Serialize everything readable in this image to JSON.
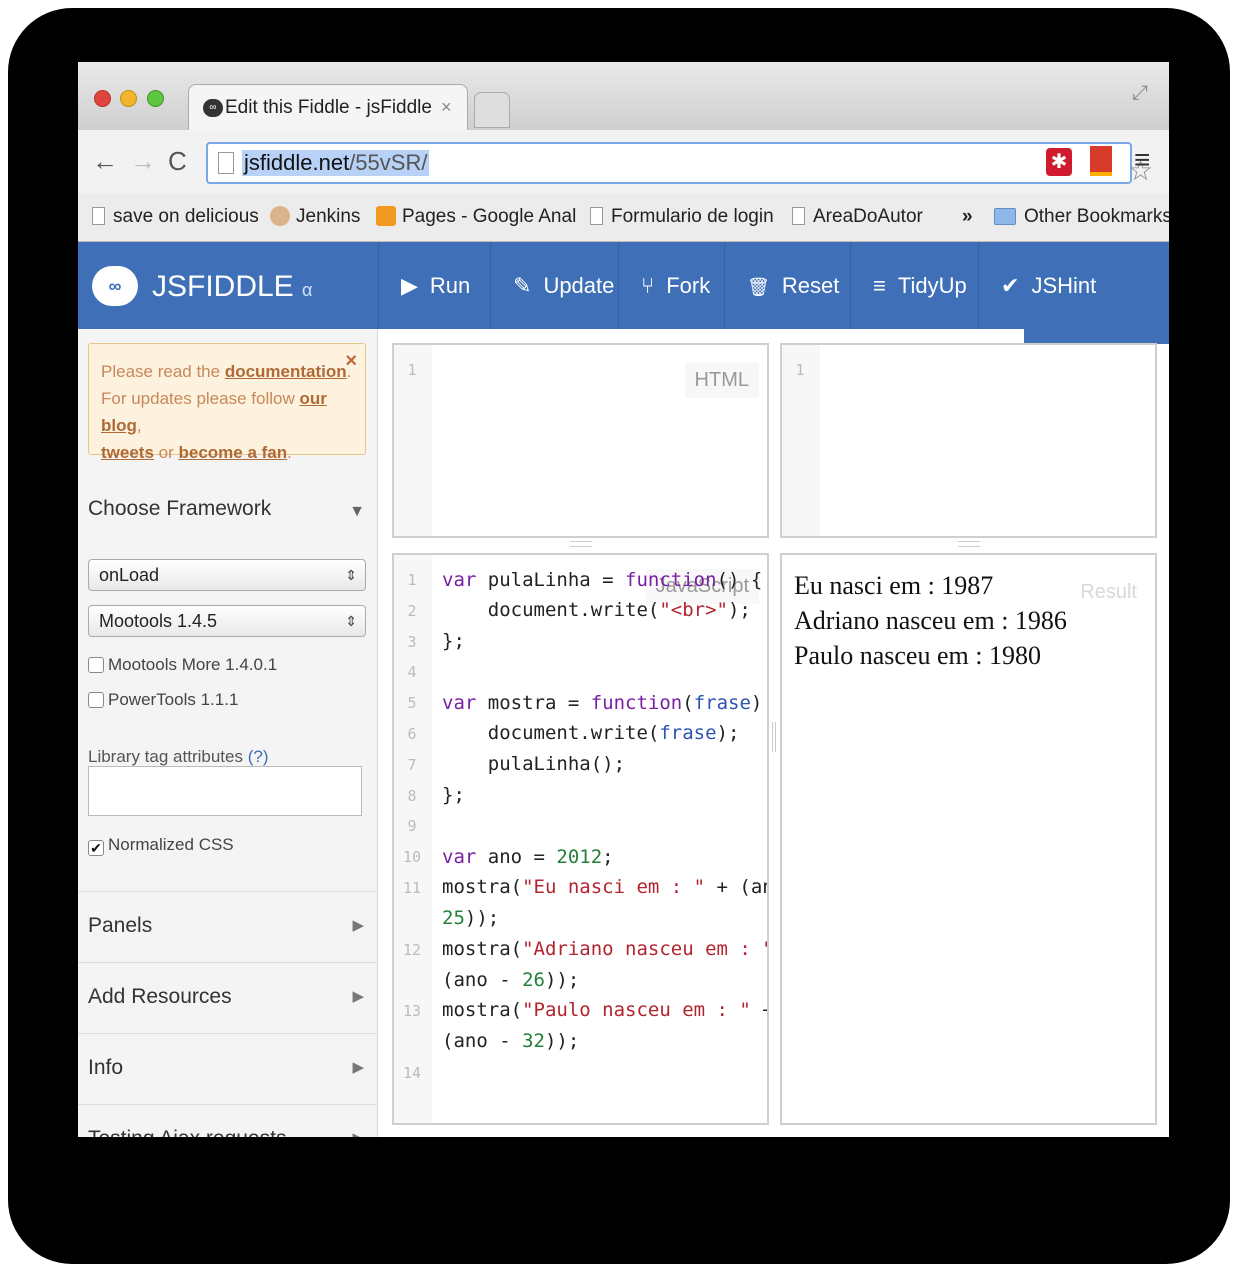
{
  "browser": {
    "tab_title": "Edit this Fiddle - jsFiddle",
    "tab_close": "×",
    "url_host": "jsfiddle.net",
    "url_path": "/55vSR/",
    "bookmarks": [
      {
        "label": "save on delicious"
      },
      {
        "label": "Jenkins"
      },
      {
        "label": "Pages - Google Anal"
      },
      {
        "label": "Formulario de login"
      },
      {
        "label": "AreaDoAutor"
      }
    ],
    "bookmarks_overflow": "»",
    "other_bookmarks": "Other Bookmarks"
  },
  "jsfiddle": {
    "brand": "JSFIDDLE",
    "brand_suffix": "α",
    "buttons": [
      {
        "label": "Run",
        "icon": "▶"
      },
      {
        "label": "Update",
        "icon": "✎"
      },
      {
        "label": "Fork",
        "icon": "⑂"
      },
      {
        "label": "Reset",
        "icon": "🗑"
      },
      {
        "label": "TidyUp",
        "icon": "≡"
      },
      {
        "label": "JSHint",
        "icon": "✔"
      }
    ]
  },
  "sidebar": {
    "notice_text_1": "Please read the ",
    "notice_link_docs": "documentation",
    "notice_text_2": ".",
    "notice_text_3": "For updates please follow ",
    "notice_link_blog": "our blog",
    "notice_text_4": ",",
    "notice_link_tweets": "tweets",
    "notice_text_5": " or ",
    "notice_link_fan": "become a fan",
    "notice_text_6": ".",
    "notice_close": "×",
    "framework_heading": "Choose Framework",
    "load_select": "onLoad",
    "framework_select": "Mootools 1.4.5",
    "checkboxes": [
      {
        "label": "Mootools More 1.4.0.1",
        "checked": false
      },
      {
        "label": "PowerTools 1.1.1",
        "checked": false
      }
    ],
    "library_label": "Library tag attributes",
    "library_help": "(?)",
    "library_value": "",
    "normalized_css": "Normalized CSS",
    "normalized_checked": true,
    "sections": [
      {
        "label": "Panels"
      },
      {
        "label": "Add Resources"
      },
      {
        "label": "Info"
      },
      {
        "label": "Testing Ajax requests"
      }
    ]
  },
  "editors": {
    "html_label": "HTML",
    "js_label": "JavaScript",
    "result_label": "Result",
    "html_line_numbers": [
      "1"
    ],
    "css_line_numbers": [
      "1"
    ],
    "js_line_numbers": [
      "1",
      "2",
      "3",
      "4",
      "5",
      "6",
      "7",
      "8",
      "9",
      "10",
      "11",
      "",
      "12",
      "",
      "13",
      "",
      "14"
    ]
  },
  "result": {
    "lines": [
      "Eu nasci em : 1987",
      "Adriano nasceu em : 1986",
      "Paulo nasceu em : 1980"
    ]
  }
}
